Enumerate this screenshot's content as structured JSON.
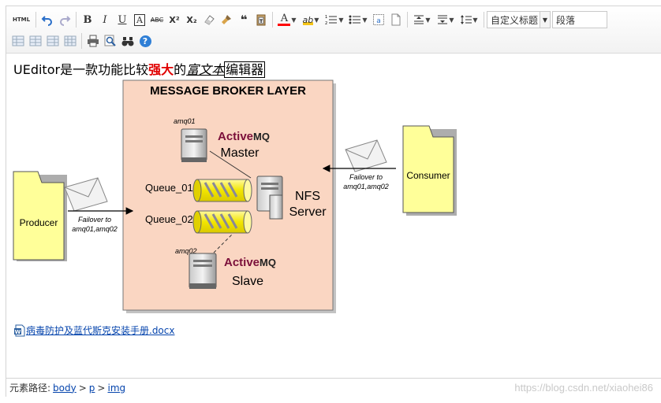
{
  "toolbar": {
    "html_label": "HTML",
    "bold": "B",
    "italic": "I",
    "underline": "U",
    "fontborder": "A",
    "strike": "ABC",
    "superscript": "X²",
    "subscript": "X₂",
    "blockquote": "❝",
    "forecolor": "A",
    "forecolor_hex": "#ff0000",
    "backcolor": "ab",
    "custom_style": "自定义标题",
    "paragraph": "段落",
    "help": "?"
  },
  "content": {
    "text_plain": "UEditor是一款功能比较",
    "text_red": "强大",
    "text_de": "的",
    "text_underline": "富文本",
    "text_box": "编辑器",
    "diagram": {
      "title": "MESSAGE BROKER LAYER",
      "amq01": "amq01",
      "amq02": "amq02",
      "activemq_active": "Active",
      "activemq_mq": "MQ",
      "master": "Master",
      "slave": "Slave",
      "queue1": "Queue_01",
      "queue2": "Queue_02",
      "nfs1": "NFS",
      "nfs2": "Server",
      "producer": "Producer",
      "consumer": "Consumer",
      "failover_left_1": "Failover to",
      "failover_left_2": "amq01,amq02",
      "failover_right_1": "Failover to",
      "failover_right_2": "amq01,amq02"
    },
    "attachment": "病毒防护及蓝代斯克安装手册.docx"
  },
  "statusbar": {
    "label": "元素路径:",
    "path": [
      "body",
      "p",
      "img"
    ],
    "separator": ">"
  },
  "watermark": "https://blog.csdn.net/xiaohei86"
}
